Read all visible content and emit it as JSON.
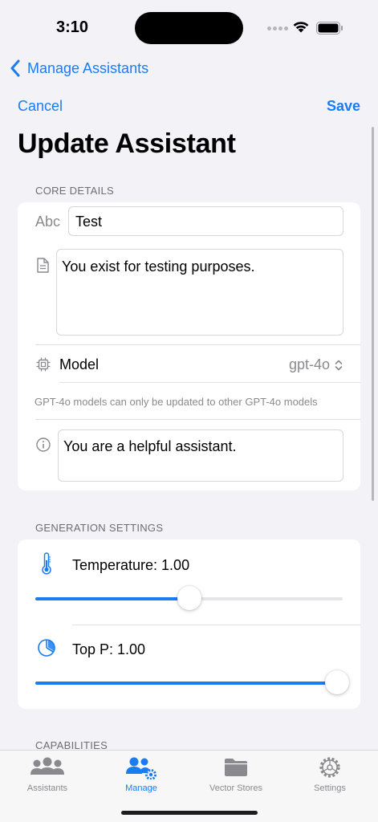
{
  "status_bar": {
    "time": "3:10"
  },
  "nav": {
    "back_label": "Manage Assistants",
    "cancel_label": "Cancel",
    "save_label": "Save",
    "title": "Update Assistant"
  },
  "core_details": {
    "header": "CORE DETAILS",
    "name_prefix": "Abc",
    "name_value": "Test",
    "description_value": "You exist for testing purposes.",
    "model_label": "Model",
    "model_value": "gpt-4o",
    "model_note": "GPT-4o models can only be updated to other GPT-4o models",
    "instructions_value": "You are a helpful assistant."
  },
  "generation_settings": {
    "header": "GENERATION SETTINGS",
    "temperature_label": "Temperature: 1.00",
    "temperature_fraction": 0.5,
    "top_p_label": "Top P: 1.00",
    "top_p_fraction": 1.0
  },
  "capabilities": {
    "header": "CAPABILITIES"
  },
  "tab_bar": {
    "tabs": [
      {
        "label": "Assistants",
        "icon": "people-icon",
        "active": false
      },
      {
        "label": "Manage",
        "icon": "people-gear-icon",
        "active": true
      },
      {
        "label": "Vector Stores",
        "icon": "folder-icon",
        "active": false
      },
      {
        "label": "Settings",
        "icon": "gear-icon",
        "active": false
      }
    ]
  },
  "colors": {
    "accent": "#1a7cf0",
    "background": "#f2f2f7",
    "secondary_text": "#8a8a8e"
  }
}
